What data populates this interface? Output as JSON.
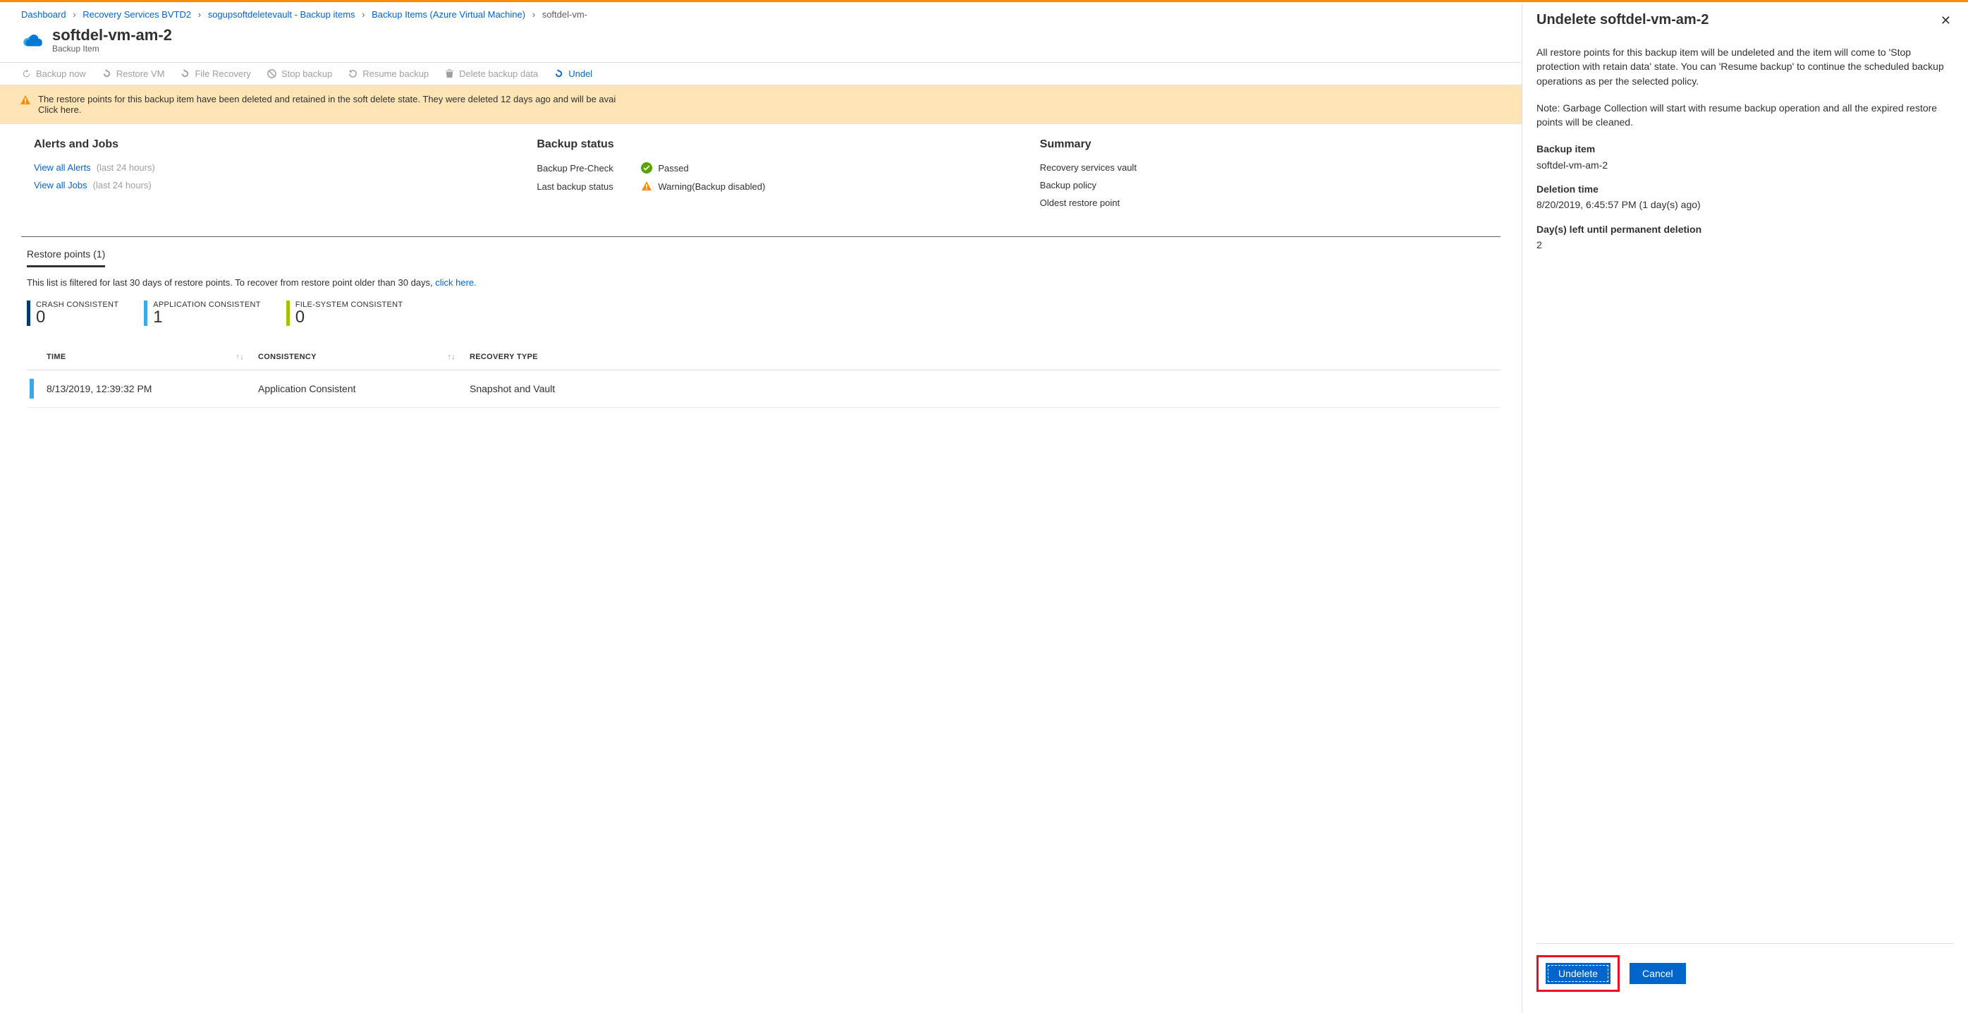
{
  "breadcrumb": [
    {
      "label": "Dashboard",
      "link": true
    },
    {
      "label": "Recovery Services BVTD2",
      "link": true
    },
    {
      "label": "sogupsoftdeletevault - Backup items",
      "link": true
    },
    {
      "label": "Backup Items (Azure Virtual Machine)",
      "link": true
    },
    {
      "label": "softdel-vm-",
      "link": false
    }
  ],
  "header": {
    "title": "softdel-vm-am-2",
    "subtitle": "Backup Item"
  },
  "toolbar": {
    "backup_now": "Backup now",
    "restore_vm": "Restore VM",
    "file_recovery": "File Recovery",
    "stop_backup": "Stop backup",
    "resume_backup": "Resume backup",
    "delete_backup_data": "Delete backup data",
    "undelete": "Undel"
  },
  "banner": {
    "text": "The restore points for this backup item have been deleted and retained in the soft delete state. They were deleted 12 days ago and will be avai",
    "link": "Click here."
  },
  "sections": {
    "alerts": {
      "title": "Alerts and Jobs",
      "all_alerts": "View all Alerts",
      "all_jobs": "View all Jobs",
      "hours": "(last 24 hours)"
    },
    "backup": {
      "title": "Backup status",
      "precheck_label": "Backup Pre-Check",
      "precheck_value": "Passed",
      "last_label": "Last backup status",
      "last_value": "Warning(Backup disabled)"
    },
    "summary": {
      "title": "Summary",
      "row1": "Recovery services vault",
      "row2": "Backup policy",
      "row3": "Oldest restore point"
    }
  },
  "restore": {
    "tab": "Restore points (1)",
    "filter_text": "This list is filtered for last 30 days of restore points. To recover from restore point older than 30 days, ",
    "filter_link": "click here.",
    "counters": {
      "crash": {
        "label": "CRASH CONSISTENT",
        "value": "0"
      },
      "app": {
        "label": "APPLICATION CONSISTENT",
        "value": "1"
      },
      "fs": {
        "label": "FILE-SYSTEM CONSISTENT",
        "value": "0"
      }
    },
    "columns": {
      "time": "TIME",
      "consistency": "CONSISTENCY",
      "recovery": "RECOVERY TYPE"
    },
    "rows": [
      {
        "time": "8/13/2019, 12:39:32 PM",
        "consistency": "Application Consistent",
        "recovery": "Snapshot and Vault"
      }
    ]
  },
  "panel": {
    "title": "Undelete softdel-vm-am-2",
    "para1": "All restore points for this backup item will be undeleted and the item will come to 'Stop protection with retain data' state. You can 'Resume backup' to continue the scheduled backup operations as per the selected policy.",
    "para2": "Note: Garbage Collection will start with resume backup operation and all the expired restore points will be cleaned.",
    "f1_label": "Backup item",
    "f1_value": "softdel-vm-am-2",
    "f2_label": "Deletion time",
    "f2_value": "8/20/2019, 6:45:57 PM (1 day(s) ago)",
    "f3_label": "Day(s) left until permanent deletion",
    "f3_value": "2",
    "undelete_btn": "Undelete",
    "cancel_btn": "Cancel"
  }
}
